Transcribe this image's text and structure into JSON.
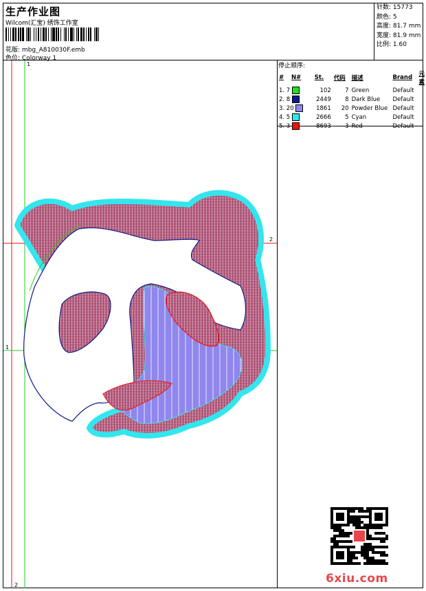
{
  "header": {
    "title": "生产作业图",
    "subtitle": "Wilcom(汇宝) 绣饰工作室",
    "design_label": "花版:",
    "design_value": "mbg_A810030F.emb",
    "colorway_label": "色位:",
    "colorway_value": "Colorway 1"
  },
  "stats": {
    "stitches_label": "针数:",
    "stitches": "15773",
    "colors_label": "颜色:",
    "colors": "5",
    "height_label": "高度:",
    "height": "81.7 mm",
    "width_label": "宽度:",
    "width": "81.9 mm",
    "scale_label": "比例:",
    "scale": "1.60"
  },
  "stop_sequence": {
    "title": "停止顺序:",
    "columns": [
      "#",
      "N#",
      "St.",
      "代码",
      "描述",
      "Brand",
      "元素"
    ],
    "rows": [
      {
        "no": "1. 7",
        "color": "#22dd22",
        "st": "102",
        "code": "7",
        "desc": "Green",
        "brand": "Default"
      },
      {
        "no": "2. 8",
        "color": "#0b1a8c",
        "st": "2449",
        "code": "8",
        "desc": "Dark Blue",
        "brand": "Default"
      },
      {
        "no": "3. 20",
        "color": "#8f86ee",
        "st": "1861",
        "code": "20",
        "desc": "Powder Blue",
        "brand": "Default"
      },
      {
        "no": "4. 5",
        "color": "#33e6ee",
        "st": "2666",
        "code": "5",
        "desc": "Cyan",
        "brand": "Default"
      },
      {
        "no": "5. 3",
        "color": "#ee1111",
        "st": "8693",
        "code": "3",
        "desc": "Red",
        "brand": "Default"
      }
    ]
  },
  "guides": {
    "v1": "1",
    "v2": "2",
    "h1": "1",
    "h2": "2"
  },
  "watermark": "6xiu.com",
  "colors": {
    "stitch_fill": "#8a1c44",
    "outline_cyan": "#33e6ee",
    "powder": "#8f86ee",
    "guide_red": "#ee1111",
    "guide_green": "#22cc22"
  }
}
